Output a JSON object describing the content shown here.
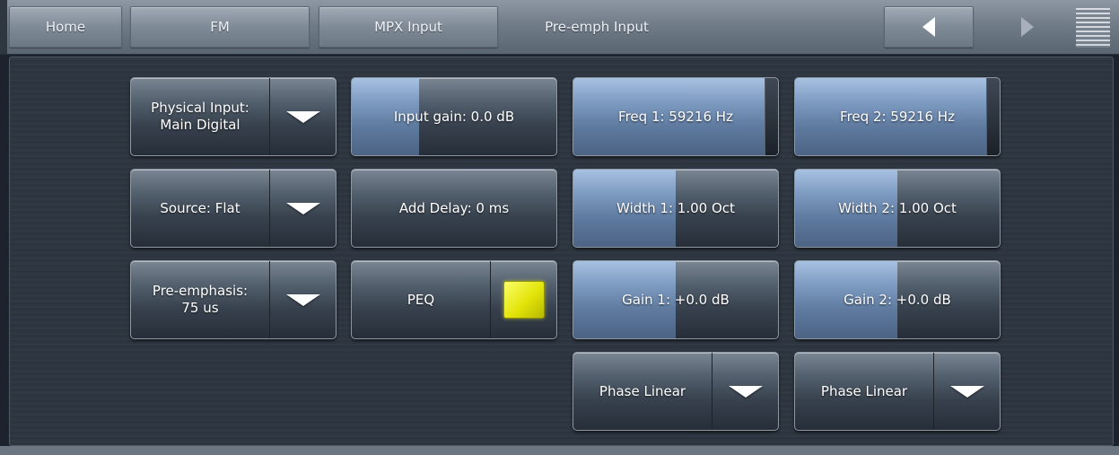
{
  "nav": {
    "home": "Home",
    "fm": "FM",
    "mpx_input": "MPX Input",
    "current": "Pre-emph Input"
  },
  "controls": {
    "physical_input": "Physical Input:\nMain Digital",
    "input_gain": "Input gain: 0.0 dB",
    "freq1": "Freq 1: 59216 Hz",
    "freq2": "Freq 2: 59216 Hz",
    "source": "Source: Flat",
    "add_delay": "Add Delay: 0 ms",
    "width1": "Width 1: 1.00 Oct",
    "width2": "Width 2: 1.00 Oct",
    "pre_emphasis": "Pre-emphasis:\n75 us",
    "peq": "PEQ",
    "gain1": "Gain 1: +0.0 dB",
    "gain2": "Gain 2: +0.0 dB",
    "phase1": "Phase Linear",
    "phase2": "Phase Linear"
  },
  "levels": {
    "input_gain": 0.33,
    "freq1": 1.0,
    "freq2": 1.0,
    "width1": 0.5,
    "width2": 0.5,
    "gain1": 0.5,
    "gain2": 0.5
  },
  "colors": {
    "peq_indicator": "#e9ea12",
    "slider_fill": "#7f9cc2"
  },
  "icons": {
    "back": "left-triangle-icon",
    "forward": "right-triangle-icon",
    "menu": "menu-lines-icon",
    "dropdown": "down-triangle-icon"
  }
}
